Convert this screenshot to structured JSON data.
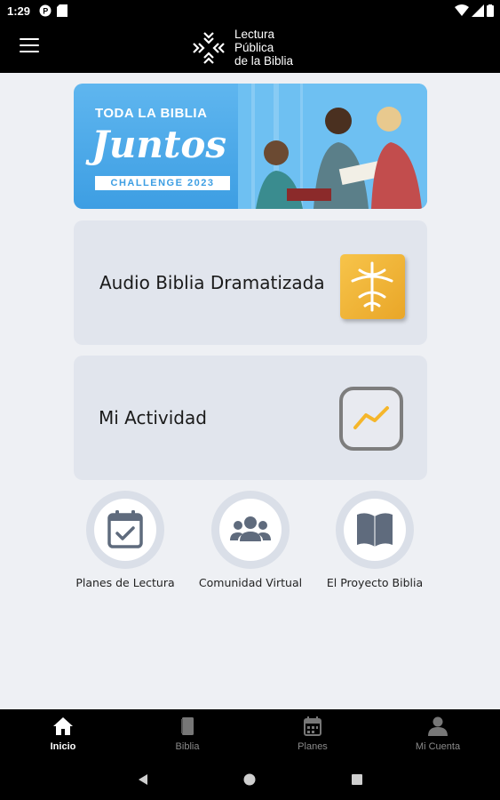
{
  "status": {
    "time": "1:29"
  },
  "header": {
    "brand_lines": [
      "Lectura",
      "Pública",
      "de la Biblia"
    ]
  },
  "banner": {
    "line1": "TODA LA BIBLIA",
    "line2": "Juntos",
    "line3": "CHALLENGE 2023"
  },
  "cards": [
    {
      "label": "Audio Biblia Dramatizada"
    },
    {
      "label": "Mi Actividad"
    }
  ],
  "shortcuts": [
    {
      "label": "Planes de Lectura",
      "icon": "calendar-check-icon"
    },
    {
      "label": "Comunidad Virtual",
      "icon": "users-icon"
    },
    {
      "label": "El Proyecto Biblia",
      "icon": "book-open-icon"
    }
  ],
  "bottom_nav": [
    {
      "label": "Inicio",
      "icon": "home-icon",
      "active": true
    },
    {
      "label": "Biblia",
      "icon": "bible-icon",
      "active": false
    },
    {
      "label": "Planes",
      "icon": "calendar-icon",
      "active": false
    },
    {
      "label": "Mi Cuenta",
      "icon": "user-icon",
      "active": false
    }
  ],
  "colors": {
    "background": "#eef0f4",
    "card": "#e1e5ed",
    "banner_blue": "#3d9ee3",
    "accent_yellow": "#f5b62b",
    "icon_gray": "#5f6b7d"
  }
}
